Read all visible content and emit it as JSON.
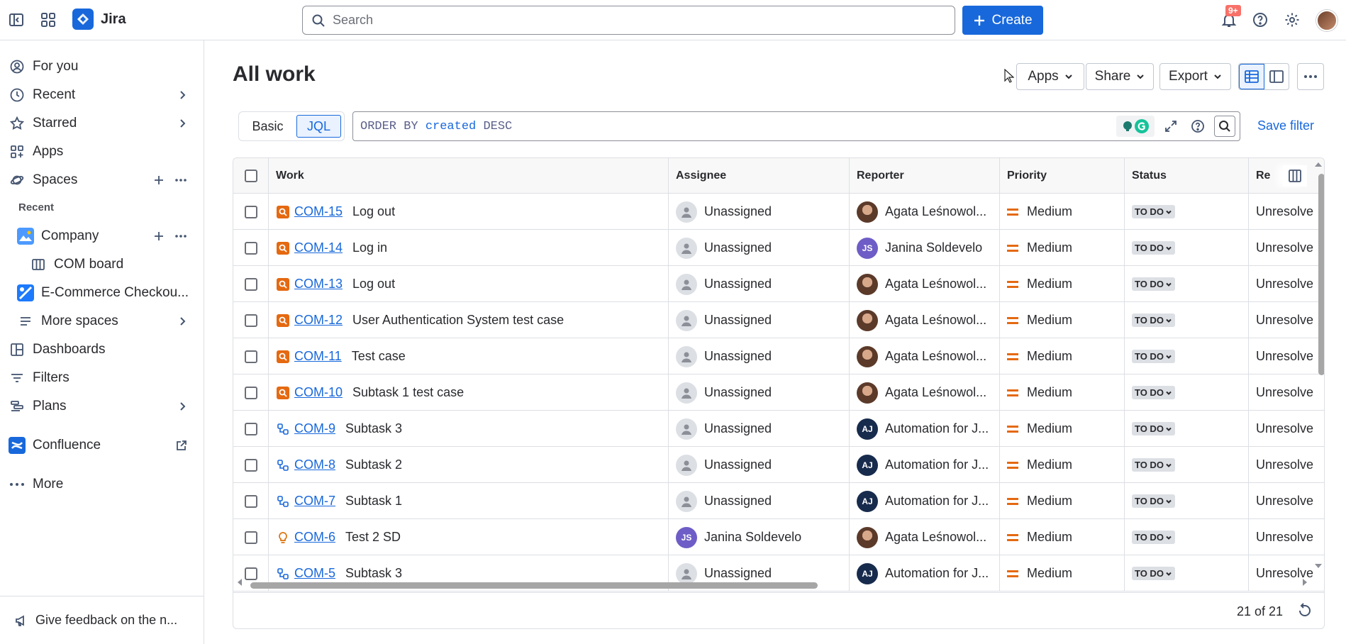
{
  "topbar": {
    "app_name": "Jira",
    "search_placeholder": "Search",
    "create_label": "Create",
    "notification_count": "9+"
  },
  "sidebar": {
    "items": [
      {
        "label": "For you"
      },
      {
        "label": "Recent"
      },
      {
        "label": "Starred"
      },
      {
        "label": "Apps"
      },
      {
        "label": "Spaces"
      }
    ],
    "recent_label": "Recent",
    "spaces": [
      {
        "label": "Company"
      },
      {
        "label": "COM board"
      },
      {
        "label": "E-Commerce Checkou..."
      },
      {
        "label": "More spaces"
      }
    ],
    "lower_items": [
      {
        "label": "Dashboards"
      },
      {
        "label": "Filters"
      },
      {
        "label": "Plans"
      },
      {
        "label": "Confluence"
      },
      {
        "label": "More"
      }
    ],
    "feedback_label": "Give feedback on the n..."
  },
  "page": {
    "title": "All work",
    "apps_label": "Apps",
    "share_label": "Share",
    "export_label": "Export",
    "mode_basic": "Basic",
    "mode_jql": "JQL",
    "jql": {
      "kw1": "ORDER BY",
      "field": "created",
      "kw2": "DESC"
    },
    "save_filter": "Save filter"
  },
  "table": {
    "columns": [
      "Work",
      "Assignee",
      "Reporter",
      "Priority",
      "Status",
      "Re"
    ],
    "rows": [
      {
        "type": "test",
        "key": "COM-15",
        "summary": "Log out",
        "assignee": "Unassigned",
        "a_av": "un",
        "reporter": "Agata Leśnowol...",
        "r_av": "photo",
        "priority": "Medium",
        "status": "TO DO",
        "resolution": "Unresolve"
      },
      {
        "type": "test",
        "key": "COM-14",
        "summary": "Log in",
        "assignee": "Unassigned",
        "a_av": "un",
        "reporter": "Janina Soldevelo",
        "r_av": "js",
        "r_initials": "JS",
        "priority": "Medium",
        "status": "TO DO",
        "resolution": "Unresolve"
      },
      {
        "type": "test",
        "key": "COM-13",
        "summary": "Log out",
        "assignee": "Unassigned",
        "a_av": "un",
        "reporter": "Agata Leśnowol...",
        "r_av": "photo",
        "priority": "Medium",
        "status": "TO DO",
        "resolution": "Unresolve"
      },
      {
        "type": "test",
        "key": "COM-12",
        "summary": "User Authentication System test case",
        "assignee": "Unassigned",
        "a_av": "un",
        "reporter": "Agata Leśnowol...",
        "r_av": "photo",
        "priority": "Medium",
        "status": "TO DO",
        "resolution": "Unresolve"
      },
      {
        "type": "test",
        "key": "COM-11",
        "summary": "Test case",
        "assignee": "Unassigned",
        "a_av": "un",
        "reporter": "Agata Leśnowol...",
        "r_av": "photo",
        "priority": "Medium",
        "status": "TO DO",
        "resolution": "Unresolve"
      },
      {
        "type": "test",
        "key": "COM-10",
        "summary": "Subtask 1 test case",
        "assignee": "Unassigned",
        "a_av": "un",
        "reporter": "Agata Leśnowol...",
        "r_av": "photo",
        "priority": "Medium",
        "status": "TO DO",
        "resolution": "Unresolve"
      },
      {
        "type": "subtask",
        "key": "COM-9",
        "summary": "Subtask 3",
        "assignee": "Unassigned",
        "a_av": "un",
        "reporter": "Automation for J...",
        "r_av": "aj",
        "r_initials": "AJ",
        "priority": "Medium",
        "status": "TO DO",
        "resolution": "Unresolve"
      },
      {
        "type": "subtask",
        "key": "COM-8",
        "summary": "Subtask 2",
        "assignee": "Unassigned",
        "a_av": "un",
        "reporter": "Automation for J...",
        "r_av": "aj",
        "r_initials": "AJ",
        "priority": "Medium",
        "status": "TO DO",
        "resolution": "Unresolve"
      },
      {
        "type": "subtask",
        "key": "COM-7",
        "summary": "Subtask 1",
        "assignee": "Unassigned",
        "a_av": "un",
        "reporter": "Automation for J...",
        "r_av": "aj",
        "r_initials": "AJ",
        "priority": "Medium",
        "status": "TO DO",
        "resolution": "Unresolve"
      },
      {
        "type": "idea",
        "key": "COM-6",
        "summary": "Test 2 SD",
        "assignee": "Janina Soldevelo",
        "a_av": "js",
        "a_initials": "JS",
        "reporter": "Agata Leśnowol...",
        "r_av": "photo",
        "priority": "Medium",
        "status": "TO DO",
        "resolution": "Unresolve"
      },
      {
        "type": "subtask",
        "key": "COM-5",
        "summary": "Subtask 3",
        "assignee": "Unassigned",
        "a_av": "un",
        "reporter": "Automation for J...",
        "r_av": "aj",
        "r_initials": "AJ",
        "priority": "Medium",
        "status": "TO DO",
        "resolution": "Unresolve"
      }
    ],
    "count": "21 of 21"
  },
  "colors": {
    "brand": "#1868db",
    "test_type": "#e56910",
    "subtask_type": "#1868db",
    "idea_type": "#d97008",
    "priority_medium": "#e56910"
  }
}
